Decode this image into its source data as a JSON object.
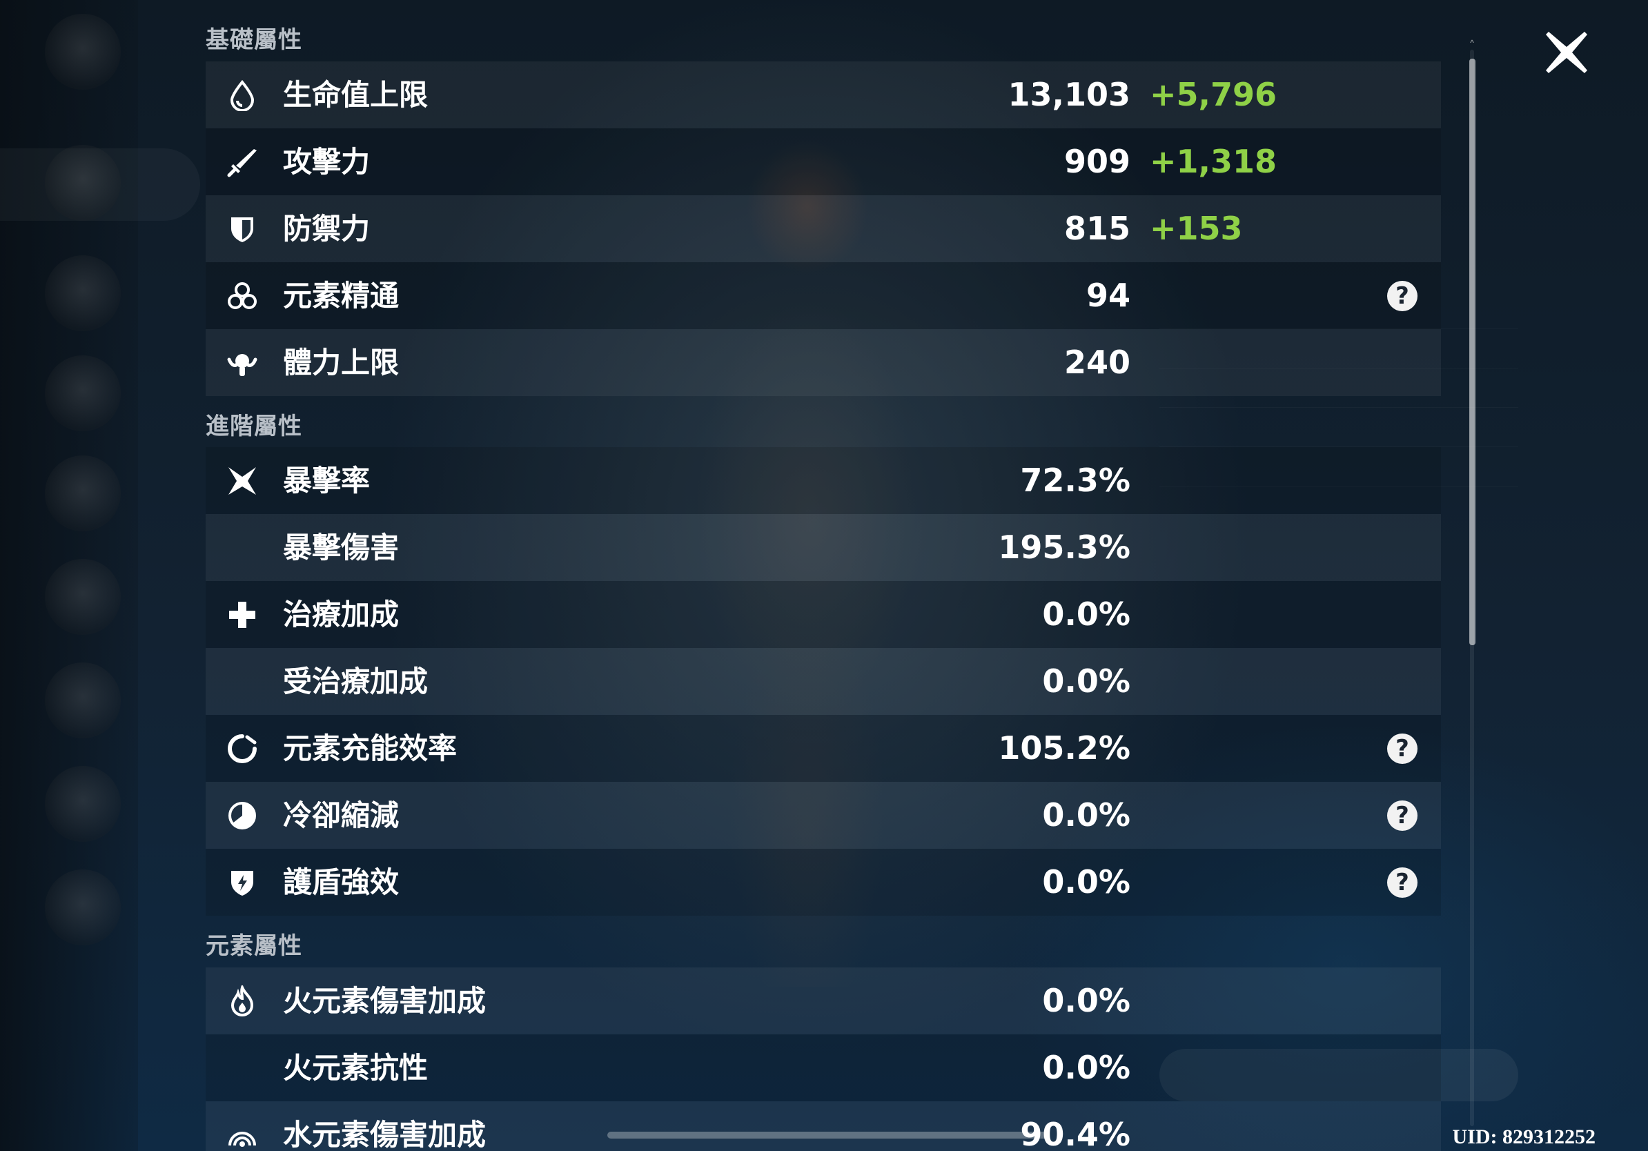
{
  "sections": {
    "basic": "基礎屬性",
    "advanced": "進階屬性",
    "elemental": "元素屬性"
  },
  "rows": [
    {
      "icon": "hp-drop-icon",
      "label": "生命值上限",
      "value": "13,103",
      "bonus": "+5,796",
      "help": false
    },
    {
      "icon": "sword-icon",
      "label": "攻擊力",
      "value": "909",
      "bonus": "+1,318",
      "help": false
    },
    {
      "icon": "shield-icon",
      "label": "防禦力",
      "value": "815",
      "bonus": "+153",
      "help": false
    },
    {
      "icon": "elemental-mastery-icon",
      "label": "元素精通",
      "value": "94",
      "bonus": "",
      "help": true
    },
    {
      "icon": "stamina-icon",
      "label": "體力上限",
      "value": "240",
      "bonus": "",
      "help": false
    },
    {
      "icon": "crit-rate-icon",
      "label": "暴擊率",
      "value": "72.3%",
      "bonus": "",
      "help": false
    },
    {
      "icon": "",
      "label": "暴擊傷害",
      "value": "195.3%",
      "bonus": "",
      "help": false
    },
    {
      "icon": "healing-cross-icon",
      "label": "治療加成",
      "value": "0.0%",
      "bonus": "",
      "help": false
    },
    {
      "icon": "",
      "label": "受治療加成",
      "value": "0.0%",
      "bonus": "",
      "help": false
    },
    {
      "icon": "energy-recharge-icon",
      "label": "元素充能效率",
      "value": "105.2%",
      "bonus": "",
      "help": true
    },
    {
      "icon": "cooldown-icon",
      "label": "冷卻縮減",
      "value": "0.0%",
      "bonus": "",
      "help": true
    },
    {
      "icon": "shield-strength-icon",
      "label": "護盾強效",
      "value": "0.0%",
      "bonus": "",
      "help": true
    },
    {
      "icon": "pyro-icon",
      "label": "火元素傷害加成",
      "value": "0.0%",
      "bonus": "",
      "help": false
    },
    {
      "icon": "",
      "label": "火元素抗性",
      "value": "0.0%",
      "bonus": "",
      "help": false
    },
    {
      "icon": "hydro-icon",
      "label": "水元素傷害加成",
      "value": "90.4%",
      "bonus": "",
      "help": false
    }
  ],
  "help_glyph": "?",
  "uid": "UID: 829312252",
  "colors": {
    "bonus": "#8fd147",
    "section_title": "#b9c0c8",
    "text": "#ffffff"
  }
}
